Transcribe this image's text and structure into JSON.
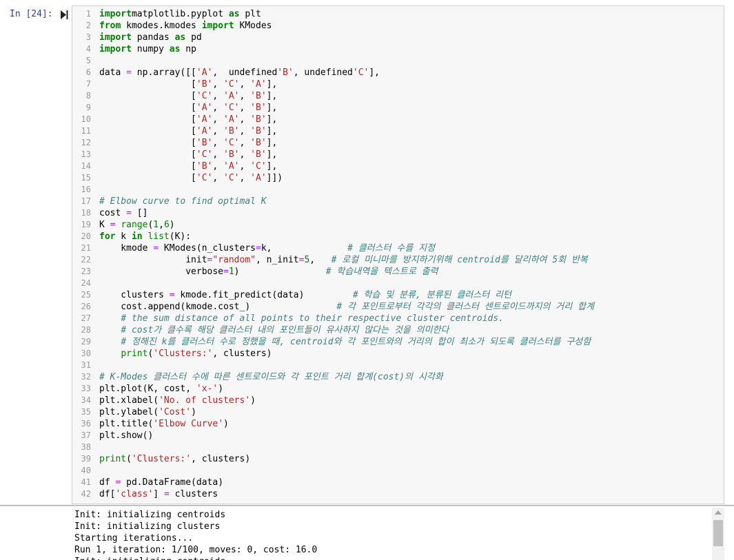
{
  "prompt": "In [24]:",
  "code_lines": [
    {
      "n": "1",
      "t": [
        [
          "kw",
          "import"
        ],
        [
          "",
          "matplotlib.pyplot "
        ],
        [
          "kw",
          "as"
        ],
        [
          "",
          " plt"
        ]
      ]
    },
    {
      "n": "2",
      "t": [
        [
          "kw",
          "from"
        ],
        [
          "",
          " kmodes.kmodes "
        ],
        [
          "kw",
          "import"
        ],
        [
          "",
          " KModes"
        ]
      ]
    },
    {
      "n": "3",
      "t": [
        [
          "kw",
          "import"
        ],
        [
          "",
          " pandas "
        ],
        [
          "kw",
          "as"
        ],
        [
          "",
          " pd"
        ]
      ]
    },
    {
      "n": "4",
      "t": [
        [
          "kw",
          "import"
        ],
        [
          "",
          " numpy "
        ],
        [
          "kw",
          "as"
        ],
        [
          "",
          " np"
        ]
      ]
    },
    {
      "n": "5",
      "t": []
    },
    {
      "n": "6",
      "t": [
        [
          "",
          "data "
        ],
        [
          "op",
          "="
        ],
        [
          "",
          " np.array([["
        ],
        [
          "str",
          "'A'"
        ],
        [
          ",  "
        ],
        [
          "str",
          "'B'"
        ],
        [
          ", "
        ],
        [
          "str",
          "'C'"
        ],
        [
          "",
          "],"
        ]
      ]
    },
    {
      "n": "7",
      "t": [
        [
          "",
          "                 ["
        ],
        [
          "str",
          "'B'"
        ],
        [
          "",
          ", "
        ],
        [
          "str",
          "'C'"
        ],
        [
          "",
          ", "
        ],
        [
          "str",
          "'A'"
        ],
        [
          "",
          "],"
        ]
      ]
    },
    {
      "n": "8",
      "t": [
        [
          "",
          "                 ["
        ],
        [
          "str",
          "'C'"
        ],
        [
          "",
          ", "
        ],
        [
          "str",
          "'A'"
        ],
        [
          "",
          ", "
        ],
        [
          "str",
          "'B'"
        ],
        [
          "",
          "],"
        ]
      ]
    },
    {
      "n": "9",
      "t": [
        [
          "",
          "                 ["
        ],
        [
          "str",
          "'A'"
        ],
        [
          "",
          ", "
        ],
        [
          "str",
          "'C'"
        ],
        [
          "",
          ", "
        ],
        [
          "str",
          "'B'"
        ],
        [
          "",
          "],"
        ]
      ]
    },
    {
      "n": "10",
      "t": [
        [
          "",
          "                 ["
        ],
        [
          "str",
          "'A'"
        ],
        [
          "",
          ", "
        ],
        [
          "str",
          "'A'"
        ],
        [
          "",
          ", "
        ],
        [
          "str",
          "'B'"
        ],
        [
          "",
          "],"
        ]
      ]
    },
    {
      "n": "11",
      "t": [
        [
          "",
          "                 ["
        ],
        [
          "str",
          "'A'"
        ],
        [
          "",
          ", "
        ],
        [
          "str",
          "'B'"
        ],
        [
          "",
          ", "
        ],
        [
          "str",
          "'B'"
        ],
        [
          "",
          "],"
        ]
      ]
    },
    {
      "n": "12",
      "t": [
        [
          "",
          "                 ["
        ],
        [
          "str",
          "'B'"
        ],
        [
          "",
          ", "
        ],
        [
          "str",
          "'C'"
        ],
        [
          "",
          ", "
        ],
        [
          "str",
          "'B'"
        ],
        [
          "",
          "],"
        ]
      ]
    },
    {
      "n": "13",
      "t": [
        [
          "",
          "                 ["
        ],
        [
          "str",
          "'C'"
        ],
        [
          "",
          ", "
        ],
        [
          "str",
          "'B'"
        ],
        [
          "",
          ", "
        ],
        [
          "str",
          "'B'"
        ],
        [
          "",
          "],"
        ]
      ]
    },
    {
      "n": "14",
      "t": [
        [
          "",
          "                 ["
        ],
        [
          "str",
          "'B'"
        ],
        [
          "",
          ", "
        ],
        [
          "str",
          "'A'"
        ],
        [
          "",
          ", "
        ],
        [
          "str",
          "'C'"
        ],
        [
          "",
          "],"
        ]
      ]
    },
    {
      "n": "15",
      "t": [
        [
          "",
          "                 ["
        ],
        [
          "str",
          "'C'"
        ],
        [
          "",
          ", "
        ],
        [
          "str",
          "'C'"
        ],
        [
          "",
          ", "
        ],
        [
          "str",
          "'A'"
        ],
        [
          "",
          "]])"
        ]
      ]
    },
    {
      "n": "16",
      "t": []
    },
    {
      "n": "17",
      "t": [
        [
          "cm",
          "# Elbow curve to find optimal K"
        ]
      ]
    },
    {
      "n": "18",
      "t": [
        [
          "",
          "cost "
        ],
        [
          "op",
          "="
        ],
        [
          "",
          " []"
        ]
      ]
    },
    {
      "n": "19",
      "t": [
        [
          "",
          "K "
        ],
        [
          "op",
          "="
        ],
        [
          " ",
          ""
        ],
        [
          "bi",
          "range"
        ],
        [
          "",
          "("
        ],
        [
          "num",
          "1"
        ],
        [
          "",
          ","
        ],
        [
          "num",
          "6"
        ],
        [
          "",
          ")"
        ]
      ]
    },
    {
      "n": "20",
      "t": [
        [
          "kw",
          "for"
        ],
        [
          "",
          " k "
        ],
        [
          "kw",
          "in"
        ],
        [
          " ",
          ""
        ],
        [
          "bi",
          "list"
        ],
        [
          "",
          "(K):"
        ]
      ]
    },
    {
      "n": "21",
      "t": [
        [
          "",
          "    kmode "
        ],
        [
          "op",
          "="
        ],
        [
          "",
          " KModes(n_clusters"
        ],
        [
          "op",
          "="
        ],
        [
          "",
          "k,              "
        ],
        [
          "cm",
          "# 클러스터 수를 지정"
        ]
      ]
    },
    {
      "n": "22",
      "t": [
        [
          "",
          "                init"
        ],
        [
          "op",
          "="
        ],
        [
          "str",
          "\"random\""
        ],
        [
          "",
          ", n_init"
        ],
        [
          "op",
          "="
        ],
        [
          "num",
          "5"
        ],
        [
          "",
          ",   "
        ],
        [
          "cm",
          "# 로컬 미니마를 방지하기위해 centroid를 달리하여 5회 반복"
        ]
      ]
    },
    {
      "n": "23",
      "t": [
        [
          "",
          "                verbose"
        ],
        [
          "op",
          "="
        ],
        [
          "num",
          "1"
        ],
        [
          "",
          ")                "
        ],
        [
          "cm",
          "# 학습내역을 텍스트로 출력"
        ]
      ]
    },
    {
      "n": "24",
      "t": []
    },
    {
      "n": "25",
      "t": [
        [
          "",
          "    clusters "
        ],
        [
          "op",
          "="
        ],
        [
          "",
          " kmode.fit_predict(data)         "
        ],
        [
          "cm",
          "# 학습 및 분류, 분류된 클러스터 리턴"
        ]
      ]
    },
    {
      "n": "26",
      "t": [
        [
          "",
          "    cost.append(kmode.cost_)                "
        ],
        [
          "cm",
          "# 각 포인트로부터 각각의 클러스터 센트로이드까지의 거리 합계"
        ]
      ]
    },
    {
      "n": "27",
      "t": [
        [
          "",
          "    "
        ],
        [
          "cm",
          "# the sum distance of all points to their respective cluster centroids."
        ]
      ]
    },
    {
      "n": "28",
      "t": [
        [
          "",
          "    "
        ],
        [
          "cm",
          "# cost가 클수록 해당 클러스터 내의 포인트들이 유사하지 않다는 것을 의미한다"
        ]
      ]
    },
    {
      "n": "29",
      "t": [
        [
          "",
          "    "
        ],
        [
          "cm",
          "# 정해진 k를 클러스터 수로 정했을 때, centroid와 각 포인트와의 거리의 합이 최소가 되도록 클러스터를 구성함"
        ]
      ]
    },
    {
      "n": "30",
      "t": [
        [
          "",
          "    "
        ],
        [
          "bi",
          "print"
        ],
        [
          "",
          "("
        ],
        [
          "str",
          "'Clusters:'"
        ],
        [
          "",
          ", clusters)"
        ]
      ]
    },
    {
      "n": "31",
      "t": []
    },
    {
      "n": "32",
      "t": [
        [
          "cm",
          "# K-Modes 클러스터 수에 따른 센트로이드와 각 포인트 거리 합계(cost)의 시각화"
        ]
      ]
    },
    {
      "n": "33",
      "t": [
        [
          "",
          "plt.plot(K, cost, "
        ],
        [
          "str",
          "'x-'"
        ],
        [
          "",
          ")"
        ]
      ]
    },
    {
      "n": "34",
      "t": [
        [
          "",
          "plt.xlabel("
        ],
        [
          "str",
          "'No. of clusters'"
        ],
        [
          "",
          ")"
        ]
      ]
    },
    {
      "n": "35",
      "t": [
        [
          "",
          "plt.ylabel("
        ],
        [
          "str",
          "'Cost'"
        ],
        [
          "",
          ")"
        ]
      ]
    },
    {
      "n": "36",
      "t": [
        [
          "",
          "plt.title("
        ],
        [
          "str",
          "'Elbow Curve'"
        ],
        [
          "",
          ")"
        ]
      ]
    },
    {
      "n": "37",
      "t": [
        [
          "",
          "plt.show()"
        ]
      ]
    },
    {
      "n": "38",
      "t": []
    },
    {
      "n": "39",
      "t": [
        [
          "bi",
          "print"
        ],
        [
          "",
          "("
        ],
        [
          "str",
          "'Clusters:'"
        ],
        [
          "",
          ", clusters)"
        ]
      ]
    },
    {
      "n": "40",
      "t": []
    },
    {
      "n": "41",
      "t": [
        [
          "",
          "df "
        ],
        [
          "op",
          "="
        ],
        [
          "",
          " pd.DataFrame(data)"
        ]
      ]
    },
    {
      "n": "42",
      "t": [
        [
          "",
          "df["
        ],
        [
          "str",
          "'class'"
        ],
        [
          "",
          "] "
        ],
        [
          "op",
          "="
        ],
        [
          "",
          " clusters"
        ]
      ]
    }
  ],
  "output_lines": [
    "Init: initializing centroids",
    "Init: initializing clusters",
    "Starting iterations...",
    "Run 1, iteration: 1/100, moves: 0, cost: 16.0",
    "Init: initializing centroids"
  ],
  "colors": {
    "keyword": "#008000",
    "string": "#BA2121",
    "comment": "#408080",
    "operator": "#AA22FF",
    "prompt": "#303F9F"
  }
}
